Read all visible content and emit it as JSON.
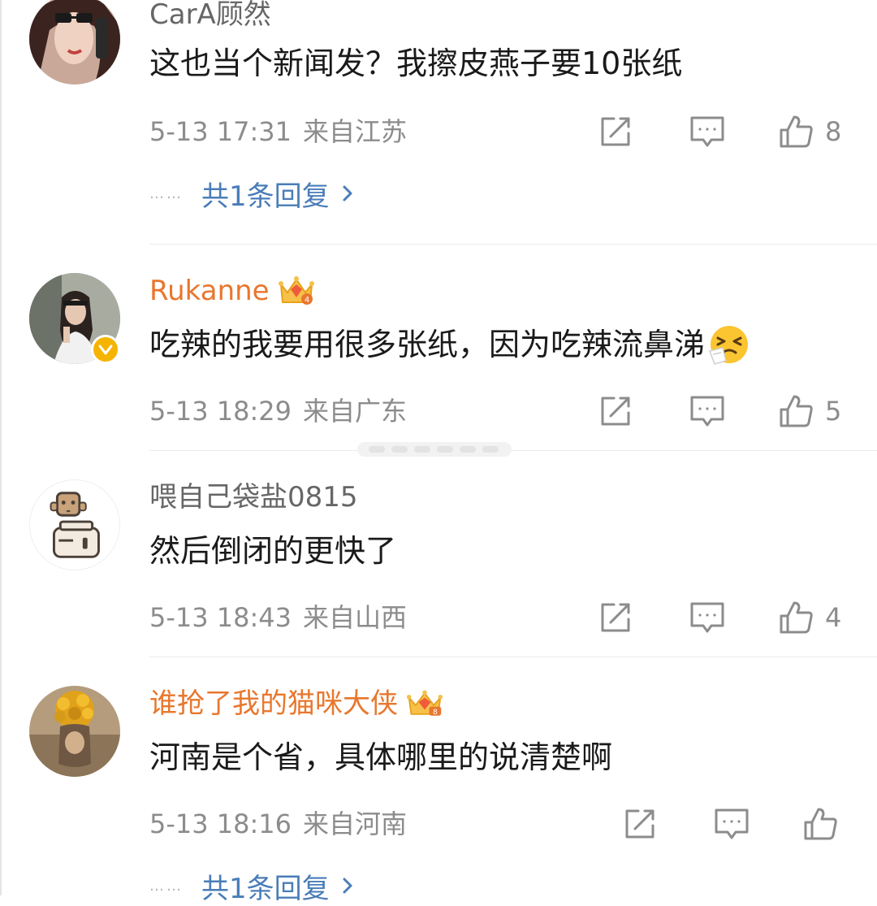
{
  "comments": [
    {
      "username": "CarA顾然",
      "content": "这也当个新闻发？我擦皮燕子要10张纸",
      "time": "5-13 17:31",
      "location": "来自江苏",
      "likes": "8",
      "replies": "共1条回复"
    },
    {
      "username": "Rukanne",
      "content": "吃辣的我要用很多张纸，因为吃辣流鼻涕",
      "emoji": "sneezing-face-emoji",
      "time": "5-13 18:29",
      "location": "来自广东",
      "likes": "5"
    },
    {
      "username": "喂自己袋盐0815",
      "content": "然后倒闭的更快了",
      "time": "5-13 18:43",
      "location": "来自山西",
      "likes": "4"
    },
    {
      "username": "谁抢了我的猫咪大侠",
      "content": "河南是个省，具体哪里的说清楚啊",
      "time": "5-13 18:16",
      "location": "来自河南",
      "likes": "",
      "replies": "共1条回复"
    }
  ],
  "ui": {
    "dots": "……",
    "chevron": "›"
  },
  "colors": {
    "vip_name": "#e8772e",
    "normal_name": "#666666",
    "link": "#4a7db8",
    "meta": "#8c8c8c",
    "text": "#1a1a1a"
  },
  "icons": {
    "share": "share-icon",
    "comment": "comment-icon",
    "like": "thumbs-up-icon",
    "vip": "crown-icon",
    "verified": "verified-badge-icon"
  }
}
